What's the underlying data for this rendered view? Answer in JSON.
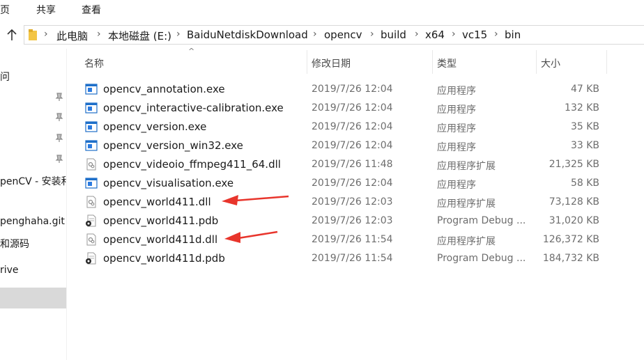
{
  "ribbon": {
    "tabs": [
      "页",
      "共享",
      "查看"
    ]
  },
  "address_bar": {
    "crumbs": [
      "此电脑",
      "本地磁盘 (E:)",
      "BaiduNetdiskDownload",
      "opencv",
      "build",
      "x64",
      "vc15",
      "bin"
    ]
  },
  "nav": {
    "items": [
      "问",
      "penCV - 安装和",
      "penghaha.git",
      "和源码",
      "rive"
    ]
  },
  "columns": {
    "name": "名称",
    "date": "修改日期",
    "type": "类型",
    "size": "大小"
  },
  "files": [
    {
      "name": "opencv_annotation.exe",
      "date": "2019/7/26 12:04",
      "type": "应用程序",
      "size": "47 KB",
      "icon": "exe-icon"
    },
    {
      "name": "opencv_interactive-calibration.exe",
      "date": "2019/7/26 12:04",
      "type": "应用程序",
      "size": "132 KB",
      "icon": "exe-icon"
    },
    {
      "name": "opencv_version.exe",
      "date": "2019/7/26 12:04",
      "type": "应用程序",
      "size": "35 KB",
      "icon": "exe-icon"
    },
    {
      "name": "opencv_version_win32.exe",
      "date": "2019/7/26 12:04",
      "type": "应用程序",
      "size": "33 KB",
      "icon": "exe-icon"
    },
    {
      "name": "opencv_videoio_ffmpeg411_64.dll",
      "date": "2019/7/26 11:48",
      "type": "应用程序扩展",
      "size": "21,325 KB",
      "icon": "dll-icon"
    },
    {
      "name": "opencv_visualisation.exe",
      "date": "2019/7/26 12:04",
      "type": "应用程序",
      "size": "58 KB",
      "icon": "exe-icon"
    },
    {
      "name": "opencv_world411.dll",
      "date": "2019/7/26 12:03",
      "type": "应用程序扩展",
      "size": "73,128 KB",
      "icon": "dll-icon"
    },
    {
      "name": "opencv_world411.pdb",
      "date": "2019/7/26 12:03",
      "type": "Program Debug ...",
      "size": "31,020 KB",
      "icon": "pdb-icon"
    },
    {
      "name": "opencv_world411d.dll",
      "date": "2019/7/26 11:54",
      "type": "应用程序扩展",
      "size": "126,372 KB",
      "icon": "dll-icon"
    },
    {
      "name": "opencv_world411d.pdb",
      "date": "2019/7/26 11:54",
      "type": "Program Debug ...",
      "size": "184,732 KB",
      "icon": "pdb-icon"
    }
  ],
  "colors": {
    "annotation_arrow": "#e8352c",
    "exe_blue": "#1e6fc9"
  }
}
